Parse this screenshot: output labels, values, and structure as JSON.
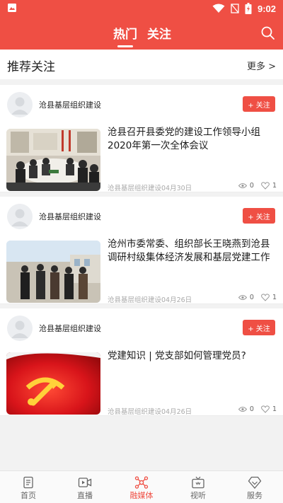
{
  "status_bar": {
    "time": "9:02"
  },
  "header": {
    "tabs": [
      {
        "label": "热门"
      },
      {
        "label": "关注"
      }
    ]
  },
  "recommend": {
    "title": "推荐关注",
    "more": "更多 >"
  },
  "follow_label": "+ 关注",
  "articles": [
    {
      "author": "沧县基层组织建设",
      "title": "沧县召开县委党的建设工作领导小组2020年第一次全体会议",
      "source_date": "沧县基层组织建设04月30日",
      "views": "0",
      "likes": "1"
    },
    {
      "author": "沧县基层组织建设",
      "title": "沧州市委常委、组织部长王晓燕到沧县调研村级集体经济发展和基层党建工作",
      "source_date": "沧县基层组织建设04月26日",
      "views": "0",
      "likes": "1"
    },
    {
      "author": "沧县基层组织建设",
      "title": "党建知识 | 党支部如何管理党员?",
      "source_date": "沧县基层组织建设04月26日",
      "views": "0",
      "likes": "1"
    }
  ],
  "bottom_nav": [
    {
      "label": "首页"
    },
    {
      "label": "直播"
    },
    {
      "label": "融媒体"
    },
    {
      "label": "视听"
    },
    {
      "label": "服务"
    }
  ],
  "colors": {
    "brand_red": "#ef4f44"
  }
}
